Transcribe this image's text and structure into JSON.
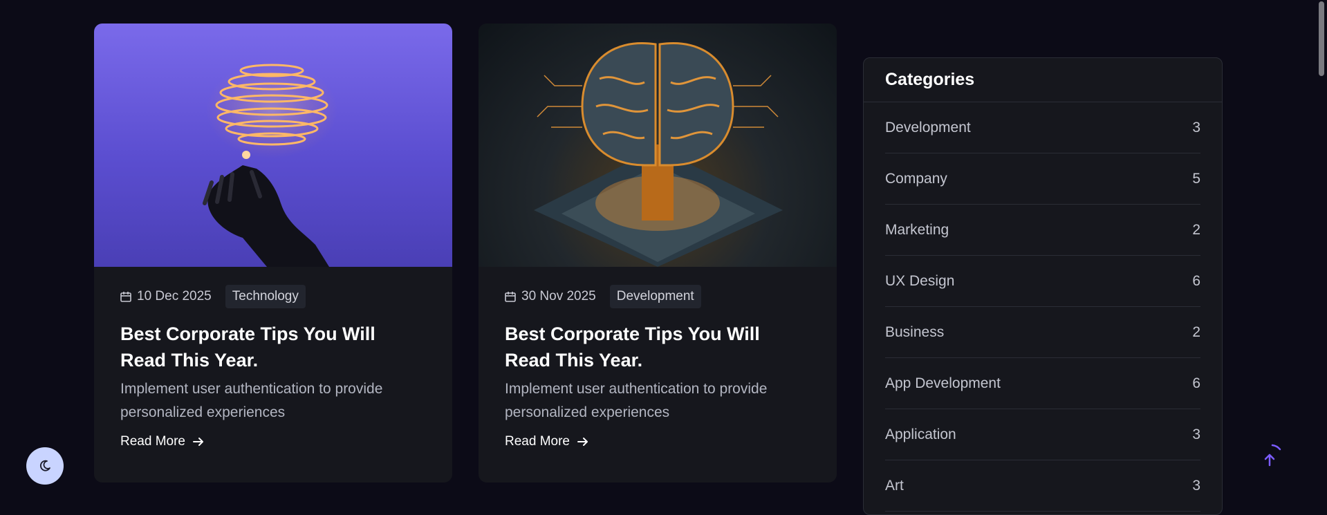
{
  "posts": [
    {
      "date": "10 Dec 2025",
      "category": "Technology",
      "title": "Best Corporate Tips You Will Read This Year.",
      "excerpt": "Implement user authentication to provide personalized experiences",
      "read_more": "Read More"
    },
    {
      "date": "30 Nov 2025",
      "category": "Development",
      "title": "Best Corporate Tips You Will Read This Year.",
      "excerpt": "Implement user authentication to provide personalized experiences",
      "read_more": "Read More"
    }
  ],
  "categories": {
    "title": "Categories",
    "items": [
      {
        "name": "Development",
        "count": "3"
      },
      {
        "name": "Company",
        "count": "5"
      },
      {
        "name": "Marketing",
        "count": "2"
      },
      {
        "name": "UX Design",
        "count": "6"
      },
      {
        "name": "Business",
        "count": "2"
      },
      {
        "name": "App Development",
        "count": "6"
      },
      {
        "name": "Application",
        "count": "3"
      },
      {
        "name": "Art",
        "count": "3"
      }
    ]
  },
  "icons": {
    "calendar": "calendar-icon",
    "arrow": "arrow-right-icon",
    "theme_toggle": "moon-icon",
    "back_to_top": "arrow-up-icon"
  },
  "colors": {
    "background": "#0c0b17",
    "card": "#16171d",
    "accent": "#7c5cff"
  }
}
